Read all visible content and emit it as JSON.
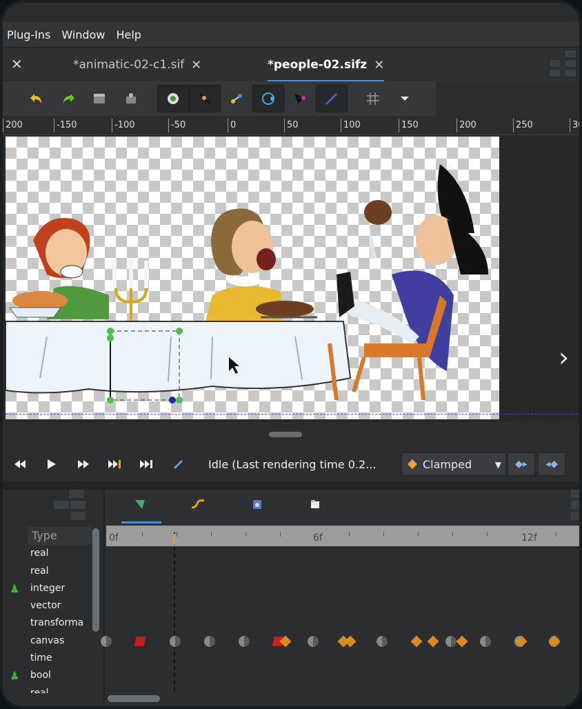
{
  "menu": [
    "Plug-Ins",
    "Window",
    "Help"
  ],
  "tabs": [
    {
      "label": "*animatic-02-c1.sif",
      "close": "✕"
    },
    {
      "label": "*people-02.sifz",
      "close": "✕"
    }
  ],
  "close_all_glyph": "✕",
  "ruler_labels": [
    "200",
    "-150",
    "-100",
    "-50",
    "0",
    "50",
    "100",
    "150",
    "200",
    "250",
    "30"
  ],
  "next_glyph": "›",
  "transport": {
    "status": "Idle (Last rendering time 0.2...",
    "interpolation": "Clamped"
  },
  "params": {
    "column_header": "Type",
    "rows": [
      "real",
      "real",
      "integer",
      "vector",
      "transforma",
      "canvas",
      "time",
      "bool",
      "real"
    ]
  },
  "timeline": {
    "labels": [
      "0f",
      "6f",
      "12f"
    ]
  },
  "colors": {
    "accent": "#4a90d9",
    "waypoint_orange": "#d98a20",
    "waypoint_red": "#c0221b"
  }
}
